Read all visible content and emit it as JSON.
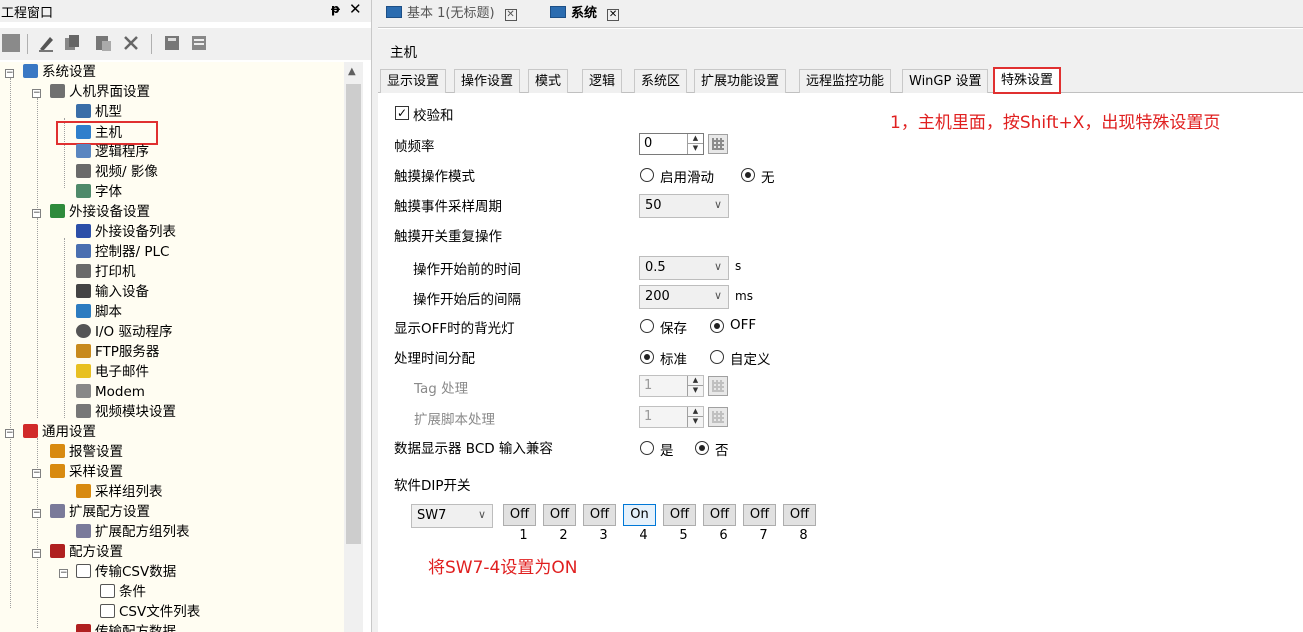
{
  "project_window": {
    "title": "工程窗口",
    "pin": "ᵽ",
    "close": "✕",
    "tree": [
      {
        "label": "系统设置"
      },
      {
        "label": "人机界面设置"
      },
      {
        "label": "机型"
      },
      {
        "label": "主机"
      },
      {
        "label": "逻辑程序"
      },
      {
        "label": "视频/ 影像"
      },
      {
        "label": "字体"
      },
      {
        "label": "外接设备设置"
      },
      {
        "label": "外接设备列表"
      },
      {
        "label": "控制器/ PLC"
      },
      {
        "label": "打印机"
      },
      {
        "label": "输入设备"
      },
      {
        "label": "脚本"
      },
      {
        "label": "I/O 驱动程序"
      },
      {
        "label": "FTP服务器"
      },
      {
        "label": "电子邮件"
      },
      {
        "label": "Modem"
      },
      {
        "label": "视频模块设置"
      },
      {
        "label": "通用设置"
      },
      {
        "label": "报警设置"
      },
      {
        "label": "采样设置"
      },
      {
        "label": "采样组列表"
      },
      {
        "label": "扩展配方设置"
      },
      {
        "label": "扩展配方组列表"
      },
      {
        "label": "配方设置"
      },
      {
        "label": "传输CSV数据"
      },
      {
        "label": "条件"
      },
      {
        "label": "CSV文件列表"
      },
      {
        "label": "传输配方数据"
      }
    ]
  },
  "doc_tabs": [
    {
      "label": "基本 1(无标题)",
      "close": "✕"
    },
    {
      "label": "系统",
      "close": "✕"
    }
  ],
  "main": {
    "header": "主机",
    "subtabs": [
      {
        "label": "显示设置"
      },
      {
        "label": "操作设置"
      },
      {
        "label": "模式"
      },
      {
        "label": "逻辑"
      },
      {
        "label": "系统区"
      },
      {
        "label": "扩展功能设置"
      },
      {
        "label": "远程监控功能"
      },
      {
        "label": "WinGP 设置"
      },
      {
        "label": "特殊设置"
      }
    ],
    "checksum": {
      "label": "校验和",
      "checked": true,
      "mark": "✓"
    },
    "frame_rate": {
      "label": "帧频率",
      "value": "0"
    },
    "touch_mode": {
      "label": "触摸操作模式",
      "opt1": "启用滑动",
      "opt2": "无",
      "selected": "无"
    },
    "touch_event_period": {
      "label": "触摸事件采样周期",
      "value": "50"
    },
    "touch_repeat": {
      "label": "触摸开关重复操作"
    },
    "before_start": {
      "label": "操作开始前的时间",
      "value": "0.5",
      "unit": "s"
    },
    "after_start": {
      "label": "操作开始后的间隔",
      "value": "200",
      "unit": "ms"
    },
    "backlight": {
      "label": "显示OFF时的背光灯",
      "opt1": "保存",
      "opt2": "OFF",
      "selected": "OFF"
    },
    "time_alloc": {
      "label": "处理时间分配",
      "opt1": "标准",
      "opt2": "自定义",
      "selected": "标准"
    },
    "tag_proc": {
      "label": "Tag 处理",
      "value": "1"
    },
    "ext_script": {
      "label": "扩展脚本处理",
      "value": "1"
    },
    "bcd_compat": {
      "label": "数据显示器 BCD 输入兼容",
      "opt1": "是",
      "opt2": "否",
      "selected": "否"
    },
    "dip": {
      "label": "软件DIP开关",
      "selector": "SW7",
      "switches": [
        {
          "state": "Off",
          "num": "1"
        },
        {
          "state": "Off",
          "num": "2"
        },
        {
          "state": "Off",
          "num": "3"
        },
        {
          "state": "On",
          "num": "4"
        },
        {
          "state": "Off",
          "num": "5"
        },
        {
          "state": "Off",
          "num": "6"
        },
        {
          "state": "Off",
          "num": "7"
        },
        {
          "state": "Off",
          "num": "8"
        }
      ]
    },
    "annotation_top": "1，主机里面，按Shift+X，出现特殊设置页",
    "annotation_bottom": "将SW7-4设置为ON"
  },
  "colors": {
    "annotation": "#e02020",
    "highlight_box": "#e03030",
    "on_button": "#0078d7"
  }
}
